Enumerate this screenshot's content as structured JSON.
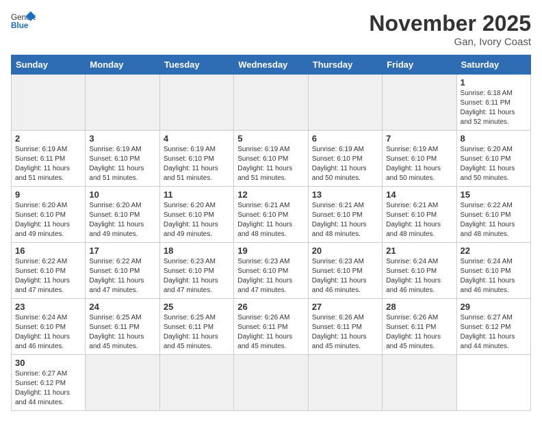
{
  "header": {
    "logo_general": "General",
    "logo_blue": "Blue",
    "month_title": "November 2025",
    "location": "Gan, Ivory Coast"
  },
  "weekdays": [
    "Sunday",
    "Monday",
    "Tuesday",
    "Wednesday",
    "Thursday",
    "Friday",
    "Saturday"
  ],
  "days": [
    {
      "num": "",
      "empty": true
    },
    {
      "num": "",
      "empty": true
    },
    {
      "num": "",
      "empty": true
    },
    {
      "num": "",
      "empty": true
    },
    {
      "num": "",
      "empty": true
    },
    {
      "num": "",
      "empty": true
    },
    {
      "num": "1",
      "sunrise": "6:18 AM",
      "sunset": "6:11 PM",
      "daylight": "11 hours and 52 minutes."
    },
    {
      "num": "2",
      "sunrise": "6:19 AM",
      "sunset": "6:11 PM",
      "daylight": "11 hours and 51 minutes."
    },
    {
      "num": "3",
      "sunrise": "6:19 AM",
      "sunset": "6:10 PM",
      "daylight": "11 hours and 51 minutes."
    },
    {
      "num": "4",
      "sunrise": "6:19 AM",
      "sunset": "6:10 PM",
      "daylight": "11 hours and 51 minutes."
    },
    {
      "num": "5",
      "sunrise": "6:19 AM",
      "sunset": "6:10 PM",
      "daylight": "11 hours and 51 minutes."
    },
    {
      "num": "6",
      "sunrise": "6:19 AM",
      "sunset": "6:10 PM",
      "daylight": "11 hours and 50 minutes."
    },
    {
      "num": "7",
      "sunrise": "6:19 AM",
      "sunset": "6:10 PM",
      "daylight": "11 hours and 50 minutes."
    },
    {
      "num": "8",
      "sunrise": "6:20 AM",
      "sunset": "6:10 PM",
      "daylight": "11 hours and 50 minutes."
    },
    {
      "num": "9",
      "sunrise": "6:20 AM",
      "sunset": "6:10 PM",
      "daylight": "11 hours and 49 minutes."
    },
    {
      "num": "10",
      "sunrise": "6:20 AM",
      "sunset": "6:10 PM",
      "daylight": "11 hours and 49 minutes."
    },
    {
      "num": "11",
      "sunrise": "6:20 AM",
      "sunset": "6:10 PM",
      "daylight": "11 hours and 49 minutes."
    },
    {
      "num": "12",
      "sunrise": "6:21 AM",
      "sunset": "6:10 PM",
      "daylight": "11 hours and 48 minutes."
    },
    {
      "num": "13",
      "sunrise": "6:21 AM",
      "sunset": "6:10 PM",
      "daylight": "11 hours and 48 minutes."
    },
    {
      "num": "14",
      "sunrise": "6:21 AM",
      "sunset": "6:10 PM",
      "daylight": "11 hours and 48 minutes."
    },
    {
      "num": "15",
      "sunrise": "6:22 AM",
      "sunset": "6:10 PM",
      "daylight": "11 hours and 48 minutes."
    },
    {
      "num": "16",
      "sunrise": "6:22 AM",
      "sunset": "6:10 PM",
      "daylight": "11 hours and 47 minutes."
    },
    {
      "num": "17",
      "sunrise": "6:22 AM",
      "sunset": "6:10 PM",
      "daylight": "11 hours and 47 minutes."
    },
    {
      "num": "18",
      "sunrise": "6:23 AM",
      "sunset": "6:10 PM",
      "daylight": "11 hours and 47 minutes."
    },
    {
      "num": "19",
      "sunrise": "6:23 AM",
      "sunset": "6:10 PM",
      "daylight": "11 hours and 47 minutes."
    },
    {
      "num": "20",
      "sunrise": "6:23 AM",
      "sunset": "6:10 PM",
      "daylight": "11 hours and 46 minutes."
    },
    {
      "num": "21",
      "sunrise": "6:24 AM",
      "sunset": "6:10 PM",
      "daylight": "11 hours and 46 minutes."
    },
    {
      "num": "22",
      "sunrise": "6:24 AM",
      "sunset": "6:10 PM",
      "daylight": "11 hours and 46 minutes."
    },
    {
      "num": "23",
      "sunrise": "6:24 AM",
      "sunset": "6:10 PM",
      "daylight": "11 hours and 46 minutes."
    },
    {
      "num": "24",
      "sunrise": "6:25 AM",
      "sunset": "6:11 PM",
      "daylight": "11 hours and 45 minutes."
    },
    {
      "num": "25",
      "sunrise": "6:25 AM",
      "sunset": "6:11 PM",
      "daylight": "11 hours and 45 minutes."
    },
    {
      "num": "26",
      "sunrise": "6:26 AM",
      "sunset": "6:11 PM",
      "daylight": "11 hours and 45 minutes."
    },
    {
      "num": "27",
      "sunrise": "6:26 AM",
      "sunset": "6:11 PM",
      "daylight": "11 hours and 45 minutes."
    },
    {
      "num": "28",
      "sunrise": "6:26 AM",
      "sunset": "6:11 PM",
      "daylight": "11 hours and 45 minutes."
    },
    {
      "num": "29",
      "sunrise": "6:27 AM",
      "sunset": "6:12 PM",
      "daylight": "11 hours and 44 minutes."
    },
    {
      "num": "30",
      "sunrise": "6:27 AM",
      "sunset": "6:12 PM",
      "daylight": "11 hours and 44 minutes."
    },
    {
      "num": "",
      "empty": true
    },
    {
      "num": "",
      "empty": true
    },
    {
      "num": "",
      "empty": true
    },
    {
      "num": "",
      "empty": true
    },
    {
      "num": "",
      "empty": true
    }
  ]
}
